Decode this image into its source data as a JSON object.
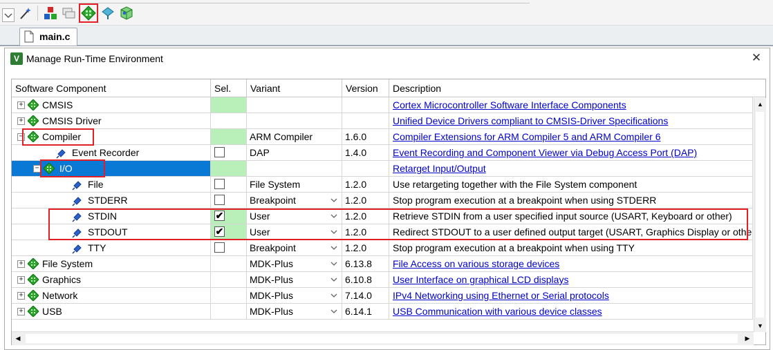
{
  "tab": {
    "label": "main.c"
  },
  "dialog": {
    "title": "Manage Run-Time Environment",
    "close_glyph": "✕"
  },
  "columns": {
    "component": "Software Component",
    "sel": "Sel.",
    "variant": "Variant",
    "version": "Version",
    "description": "Description"
  },
  "rows": [
    {
      "name": "CMSIS",
      "variant": "",
      "version": "",
      "description": "Cortex Microcontroller Software Interface Components"
    },
    {
      "name": "CMSIS Driver",
      "variant": "",
      "version": "",
      "description": "Unified Device Drivers compliant to CMSIS-Driver Specifications"
    },
    {
      "name": "Compiler",
      "variant": "ARM Compiler",
      "version": "1.6.0",
      "description": "Compiler Extensions for ARM Compiler 5 and ARM Compiler 6"
    },
    {
      "name": "Event Recorder",
      "variant": "DAP",
      "version": "1.4.0",
      "description": "Event Recording and Component Viewer via Debug Access Port (DAP)"
    },
    {
      "name": "I/O",
      "variant": "",
      "version": "",
      "description": "Retarget Input/Output"
    },
    {
      "name": "File",
      "variant": "File System",
      "version": "1.2.0",
      "description": "Use retargeting together with the File System component"
    },
    {
      "name": "STDERR",
      "variant": "Breakpoint",
      "version": "1.2.0",
      "description": "Stop program execution at a breakpoint when using STDERR"
    },
    {
      "name": "STDIN",
      "variant": "User",
      "version": "1.2.0",
      "description": "Retrieve STDIN from a user specified input source  (USART, Keyboard or other)"
    },
    {
      "name": "STDOUT",
      "variant": "User",
      "version": "1.2.0",
      "description": "Redirect STDOUT to a user defined output target (USART, Graphics Display or other)"
    },
    {
      "name": "TTY",
      "variant": "Breakpoint",
      "version": "1.2.0",
      "description": "Stop program execution at a breakpoint when using TTY"
    },
    {
      "name": "File System",
      "variant": "MDK-Plus",
      "version": "6.13.8",
      "description": "File Access on various storage devices"
    },
    {
      "name": "Graphics",
      "variant": "MDK-Plus",
      "version": "6.10.8",
      "description": "User Interface on graphical LCD displays"
    },
    {
      "name": "Network",
      "variant": "MDK-Plus",
      "version": "7.14.0",
      "description": "IPv4 Networking using Ethernet or Serial protocols"
    },
    {
      "name": "USB",
      "variant": "MDK-Plus",
      "version": "6.14.1",
      "description": "USB Communication with various device classes"
    }
  ],
  "checked": {
    "STDIN": true,
    "STDOUT": true,
    "Event Recorder": false,
    "File": false,
    "STDERR": false,
    "TTY": false
  },
  "colors": {
    "selection_bg": "#0a79d6",
    "sel_green": "#b9f0b9",
    "link": "#0000cc",
    "highlight": "#e31e24",
    "gem_green": "#2aa52a"
  },
  "icons": [
    "dropdown-icon",
    "wand-icon",
    "components-icon",
    "layers-icon",
    "manage-rte-icon",
    "pack-select-icon",
    "pack-installer-icon",
    "file-icon",
    "rte-app-icon",
    "close-icon",
    "component-gem-icon",
    "pin-icon",
    "checkmark-icon",
    "chevron-down-icon"
  ]
}
